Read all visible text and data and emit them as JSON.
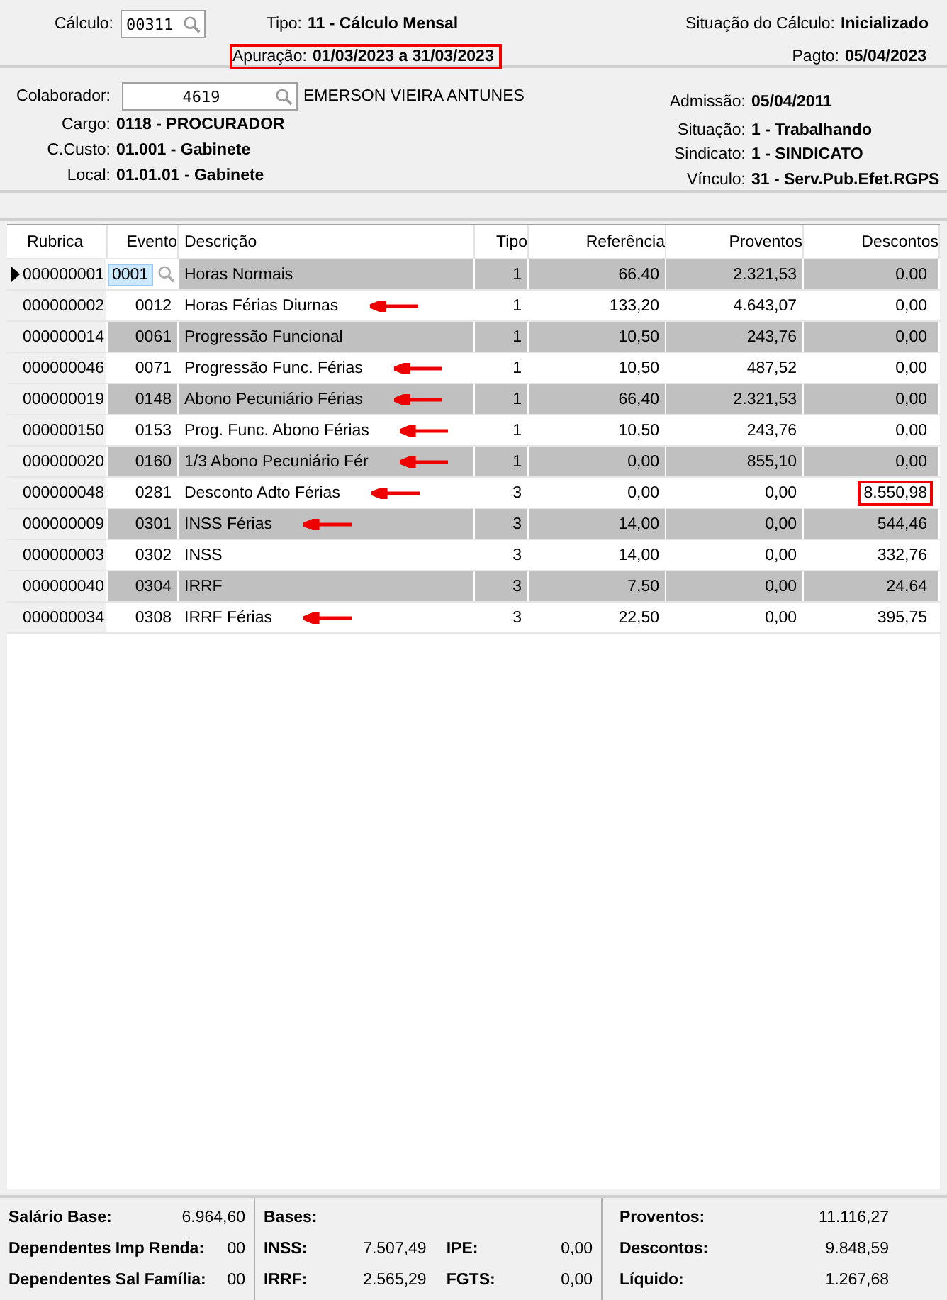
{
  "calculo": {
    "label": "Cálculo:",
    "value": "00311",
    "tipo_label": "Tipo:",
    "tipo": "11 - Cálculo Mensal",
    "apuracao_label": "Apuração:",
    "apuracao": "01/03/2023 a 31/03/2023",
    "apuracao_boxed": true,
    "situacao_label": "Situação do Cálculo:",
    "situacao": "Inicializado",
    "pagto_label": "Pagto:",
    "pagto": "05/04/2023"
  },
  "colaborador": {
    "label": "Colaborador:",
    "value": "4619",
    "name": "EMERSON VIEIRA ANTUNES",
    "left": [
      {
        "label": "Cargo:",
        "value": "0118 - PROCURADOR"
      },
      {
        "label": "C.Custo:",
        "value": "01.001 - Gabinete"
      },
      {
        "label": "Local:",
        "value": "01.01.01 - Gabinete"
      }
    ],
    "right": [
      {
        "label": "Admissão:",
        "value": "05/04/2011"
      },
      {
        "label": "Situação:",
        "value": "1 - Trabalhando"
      },
      {
        "label": "Sindicato:",
        "value": "1 - SINDICATO"
      },
      {
        "label": "Vínculo:",
        "value": "31 - Serv.Pub.Efet.RGPS"
      }
    ]
  },
  "table": {
    "columns": [
      "Rubrica",
      "Evento",
      "Descrição",
      "Tipo",
      "Referência",
      "Proventos",
      "Descontos"
    ],
    "rows": [
      {
        "rubrica": "000000001",
        "evento": "0001",
        "descricao": "Horas Normais",
        "tipo": "1",
        "referencia": "66,40",
        "proventos": "2.321,53",
        "descontos": "0,00",
        "selected": true,
        "arrow": false,
        "descontos_boxed": false
      },
      {
        "rubrica": "000000002",
        "evento": "0012",
        "descricao": "Horas Férias Diurnas",
        "tipo": "1",
        "referencia": "133,20",
        "proventos": "4.643,07",
        "descontos": "0,00",
        "selected": false,
        "arrow": true,
        "descontos_boxed": false
      },
      {
        "rubrica": "000000014",
        "evento": "0061",
        "descricao": "Progressão Funcional",
        "tipo": "1",
        "referencia": "10,50",
        "proventos": "243,76",
        "descontos": "0,00",
        "selected": false,
        "arrow": false,
        "descontos_boxed": false
      },
      {
        "rubrica": "000000046",
        "evento": "0071",
        "descricao": "Progressão Func. Férias",
        "tipo": "1",
        "referencia": "10,50",
        "proventos": "487,52",
        "descontos": "0,00",
        "selected": false,
        "arrow": true,
        "descontos_boxed": false
      },
      {
        "rubrica": "000000019",
        "evento": "0148",
        "descricao": "Abono Pecuniário Férias",
        "tipo": "1",
        "referencia": "66,40",
        "proventos": "2.321,53",
        "descontos": "0,00",
        "selected": false,
        "arrow": true,
        "descontos_boxed": false
      },
      {
        "rubrica": "000000150",
        "evento": "0153",
        "descricao": "Prog. Func. Abono Férias",
        "tipo": "1",
        "referencia": "10,50",
        "proventos": "243,76",
        "descontos": "0,00",
        "selected": false,
        "arrow": true,
        "descontos_boxed": false
      },
      {
        "rubrica": "000000020",
        "evento": "0160",
        "descricao": "1/3 Abono Pecuniário Fér",
        "tipo": "1",
        "referencia": "0,00",
        "proventos": "855,10",
        "descontos": "0,00",
        "selected": false,
        "arrow": true,
        "descontos_boxed": false
      },
      {
        "rubrica": "000000048",
        "evento": "0281",
        "descricao": "Desconto Adto Férias",
        "tipo": "3",
        "referencia": "0,00",
        "proventos": "0,00",
        "descontos": "8.550,98",
        "selected": false,
        "arrow": true,
        "descontos_boxed": true
      },
      {
        "rubrica": "000000009",
        "evento": "0301",
        "descricao": "INSS Férias",
        "tipo": "3",
        "referencia": "14,00",
        "proventos": "0,00",
        "descontos": "544,46",
        "selected": false,
        "arrow": true,
        "descontos_boxed": false
      },
      {
        "rubrica": "000000003",
        "evento": "0302",
        "descricao": "INSS",
        "tipo": "3",
        "referencia": "14,00",
        "proventos": "0,00",
        "descontos": "332,76",
        "selected": false,
        "arrow": false,
        "descontos_boxed": false
      },
      {
        "rubrica": "000000040",
        "evento": "0304",
        "descricao": "IRRF",
        "tipo": "3",
        "referencia": "7,50",
        "proventos": "0,00",
        "descontos": "24,64",
        "selected": false,
        "arrow": false,
        "descontos_boxed": false
      },
      {
        "rubrica": "000000034",
        "evento": "0308",
        "descricao": "IRRF Férias",
        "tipo": "3",
        "referencia": "22,50",
        "proventos": "0,00",
        "descontos": "395,75",
        "selected": false,
        "arrow": true,
        "descontos_boxed": false
      }
    ]
  },
  "footer": {
    "left": [
      {
        "label": "Salário Base:",
        "value": "6.964,60"
      },
      {
        "label": "Dependentes Imp Renda:",
        "value": "00"
      },
      {
        "label": "Dependentes Sal Família:",
        "value": "00"
      }
    ],
    "bases_label": "Bases:",
    "bases": [
      {
        "label": "INSS:",
        "value": "7.507,49",
        "label2": "IPE:",
        "value2": "0,00"
      },
      {
        "label": "IRRF:",
        "value": "2.565,29",
        "label2": "FGTS:",
        "value2": "0,00"
      }
    ],
    "totals": [
      {
        "label": "Proventos:",
        "value": "11.116,27"
      },
      {
        "label": "Descontos:",
        "value": "9.848,59"
      },
      {
        "label": "Líquido:",
        "value": "1.267,68"
      }
    ]
  }
}
